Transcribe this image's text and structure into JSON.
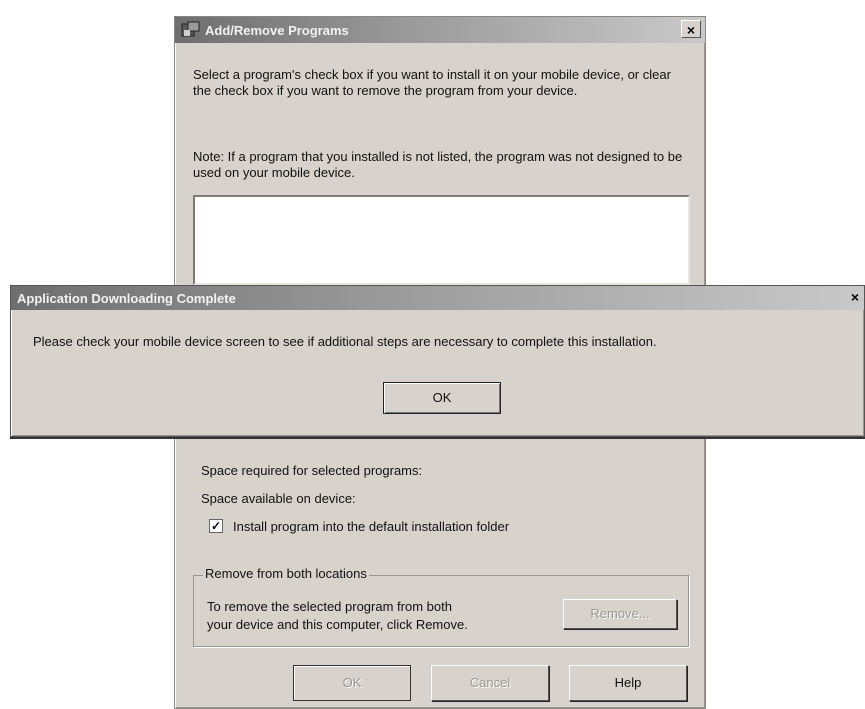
{
  "add_remove": {
    "title": "Add/Remove Programs",
    "close": "×",
    "instructions": "Select a program's check box if you want to install it on your mobile device, or clear the check box if you want to remove the program from your device.",
    "note": "Note:  If a program that you installed is not listed, the program was not designed to be used on your mobile device.",
    "space_required": "Space required for selected programs:",
    "space_available": "Space available on device:",
    "install_default_checked": true,
    "install_default_label": "Install program into the default installation folder",
    "remove_group_label": "Remove from both locations",
    "remove_text_1": "To remove the selected program from both",
    "remove_text_2": "your device and this computer, click Remove.",
    "remove_button": "Remove...",
    "ok_button": "OK",
    "cancel_button": "Cancel",
    "help_button": "Help"
  },
  "download_dialog": {
    "title": "Application Downloading Complete",
    "close": "×",
    "message": "Please check your mobile device screen to see if additional steps are necessary to complete this installation.",
    "ok_button": "OK"
  }
}
